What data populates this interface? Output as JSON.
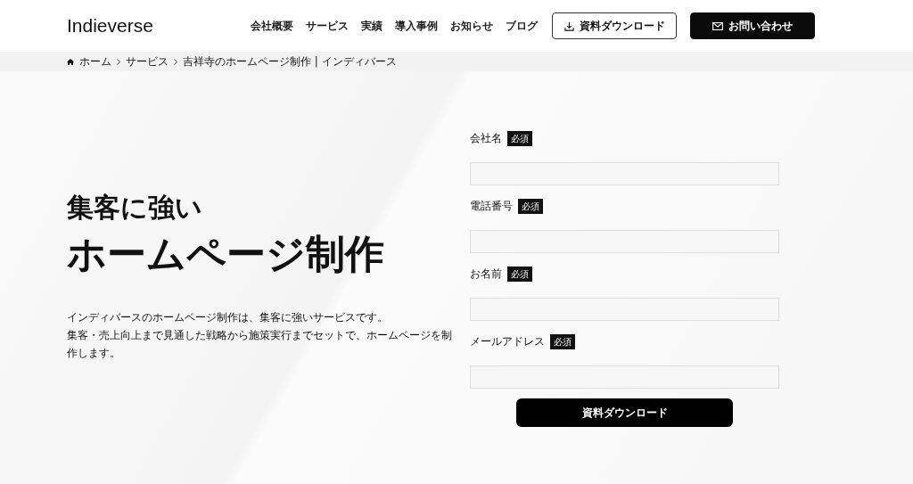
{
  "header": {
    "logo": "Indieverse",
    "nav": [
      "会社概要",
      "サービス",
      "実績",
      "導入事例",
      "お知らせ",
      "ブログ"
    ],
    "buttons": [
      {
        "label": "資料ダウンロード",
        "kind": "outline"
      },
      {
        "label": "お問い合わせ",
        "kind": "dark"
      }
    ]
  },
  "breadcrumb": [
    "ホーム",
    "サービス",
    "吉祥寺のホームページ制作 | インディバース"
  ],
  "hero": {
    "subtitle": "集客に強い",
    "title": "ホームページ制作",
    "description": [
      "インディバースのホームページ制作は、集客に強いサービスです。",
      "集客・売上向上まで見通した戦略から施策実行までセットで、ホームページを制作します。"
    ]
  },
  "form": {
    "fields": [
      {
        "label": "会社名",
        "required": true,
        "badge": "必須"
      },
      {
        "label": "電話番号",
        "required": true,
        "badge": "必須"
      },
      {
        "label": "お名前",
        "required": true,
        "badge": "必須"
      },
      {
        "label": "メールアドレス",
        "required": true,
        "badge": "必須"
      }
    ],
    "submit": "資料ダウンロード"
  }
}
